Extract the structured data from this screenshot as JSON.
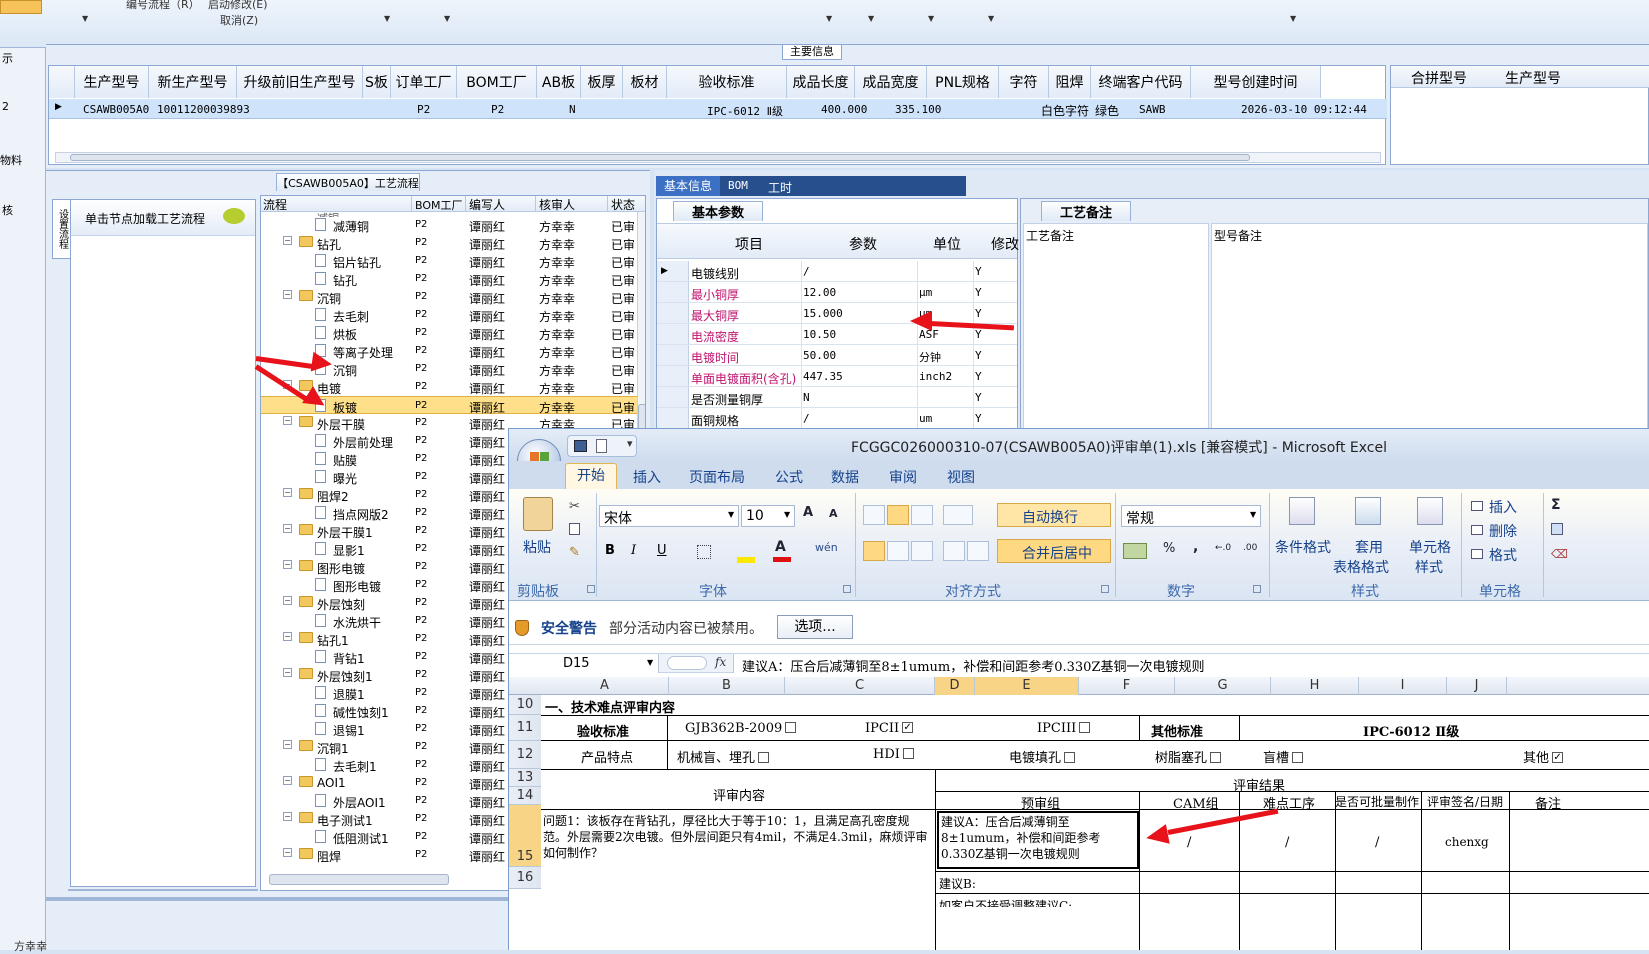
{
  "topbar": {
    "btn1": "编号流程（R）",
    "btn2": "启动修改(E)",
    "btn3": "取消(Z)"
  },
  "left_strip": {
    "items": [
      "示",
      "2",
      "物料",
      "核"
    ]
  },
  "main_info": {
    "title": "主要信息",
    "columns": [
      "生产型号",
      "新生产型号",
      "升级前旧生产型号",
      "S板",
      "订单工厂",
      "BOM工厂",
      "AB板",
      "板厚",
      "板材",
      "验收标准",
      "成品长度",
      "成品宽度",
      "PNL规格",
      "字符",
      "阻焊",
      "终端客户代码",
      "型号创建时间"
    ],
    "row": {
      "model": "CSAWB005A0",
      "new_model": "10011200039893",
      "order_factory": "P2",
      "bom_factory": "P2",
      "ab": "N",
      "standard": "IPC-6012 Ⅱ级",
      "length": "400.000",
      "width": "335.100",
      "char": "白色字符",
      "mask": "绿色",
      "customer": "SAWB",
      "created": "2026-03-10 09:12:44"
    },
    "side_columns": [
      "合拼型号",
      "生产型号"
    ]
  },
  "process": {
    "title": "【CSAWB005A0】工艺流程",
    "vtab": "设置流程",
    "hint": "单击节点加载工艺流程",
    "columns": [
      "流程",
      "BOM工厂",
      "编写人",
      "核审人",
      "状态"
    ],
    "rows": [
      {
        "name": "减薄铜",
        "level": 2
      },
      {
        "name": "钻孔",
        "level": 1
      },
      {
        "name": "铝片钻孔",
        "level": 2
      },
      {
        "name": "钻孔",
        "level": 2
      },
      {
        "name": "沉铜",
        "level": 1
      },
      {
        "name": "去毛刺",
        "level": 2
      },
      {
        "name": "烘板",
        "level": 2
      },
      {
        "name": "等离子处理",
        "level": 2
      },
      {
        "name": "沉铜",
        "level": 2
      },
      {
        "name": "电镀",
        "level": 1
      },
      {
        "name": "板镀",
        "level": 2,
        "selected": true
      },
      {
        "name": "外层干膜",
        "level": 1
      },
      {
        "name": "外层前处理",
        "level": 2
      },
      {
        "name": "贴膜",
        "level": 2
      },
      {
        "name": "曝光",
        "level": 2
      },
      {
        "name": "阻焊2",
        "level": 1
      },
      {
        "name": "挡点网版2",
        "level": 2
      },
      {
        "name": "外层干膜1",
        "level": 1
      },
      {
        "name": "显影1",
        "level": 2
      },
      {
        "name": "图形电镀",
        "level": 1
      },
      {
        "name": "图形电镀",
        "level": 2
      },
      {
        "name": "外层蚀刻",
        "level": 1
      },
      {
        "name": "水洗烘干",
        "level": 2
      },
      {
        "name": "钻孔1",
        "level": 1
      },
      {
        "name": "背钻1",
        "level": 2
      },
      {
        "name": "外层蚀刻1",
        "level": 1
      },
      {
        "name": "退膜1",
        "level": 2
      },
      {
        "name": "碱性蚀刻1",
        "level": 2
      },
      {
        "name": "退锡1",
        "level": 2
      },
      {
        "name": "沉铜1",
        "level": 1
      },
      {
        "name": "去毛刺1",
        "level": 2
      },
      {
        "name": "AOI1",
        "level": 1
      },
      {
        "name": "外层AOI1",
        "level": 2
      },
      {
        "name": "电子测试1",
        "level": 1
      },
      {
        "name": "低阻测试1",
        "level": 2
      },
      {
        "name": "阻焊",
        "level": 1
      }
    ],
    "bom": "P2",
    "writer": "谭丽红",
    "checker": "方幸幸",
    "status": "已审",
    "partial_top": "减铜"
  },
  "detail": {
    "tabs": [
      "基本信息",
      "BOM",
      "工时"
    ],
    "basic_title": "基本参数",
    "process_note_title": "工艺备注",
    "columns": [
      "项目",
      "参数",
      "单位",
      "修改"
    ],
    "note_columns": [
      "工艺备注",
      "型号备注"
    ],
    "params": [
      {
        "name": "电镀线别",
        "value": "/",
        "unit": "",
        "flag": "Y",
        "color": "#000"
      },
      {
        "name": "最小铜厚",
        "value": "12.00",
        "unit": "μm",
        "flag": "Y",
        "color": "#c0136e"
      },
      {
        "name": "最大铜厚",
        "value": "15.000",
        "unit": "μm",
        "flag": "Y",
        "color": "#c0136e"
      },
      {
        "name": "电流密度",
        "value": "10.50",
        "unit": "ASF",
        "flag": "Y",
        "color": "#c0136e"
      },
      {
        "name": "电镀时间",
        "value": "50.00",
        "unit": "分钟",
        "flag": "Y",
        "color": "#c0136e"
      },
      {
        "name": "单面电镀面积(含孔)",
        "value": "447.35",
        "unit": "inch2",
        "flag": "Y",
        "color": "#c0136e"
      },
      {
        "name": "是否测量铜厚",
        "value": "N",
        "unit": "",
        "flag": "Y",
        "color": "#000"
      },
      {
        "name": "面铜规格",
        "value": "/",
        "unit": "um",
        "flag": "Y",
        "color": "#000"
      }
    ]
  },
  "excel": {
    "title": "FCGGC026000310-07(CSAWB005A0)评审单(1).xls  [兼容模式] - Microsoft Excel",
    "tabs": [
      "开始",
      "插入",
      "页面布局",
      "公式",
      "数据",
      "审阅",
      "视图"
    ],
    "font_name": "宋体",
    "font_size": "10",
    "number_format": "常规",
    "buttons": {
      "paste": "粘贴",
      "wrap": "自动换行",
      "merge": "合并后居中",
      "cond": "条件格式",
      "table1": "套用",
      "table2": "表格格式",
      "cell1": "单元格",
      "cell2": "样式",
      "insert": "插入",
      "delete": "删除",
      "format": "格式"
    },
    "groups": [
      "剪贴板",
      "字体",
      "对齐方式",
      "数字",
      "样式",
      "单元格"
    ],
    "security_label": "安全警告",
    "security_text": "部分活动内容已被禁用。",
    "options_btn": "选项...",
    "namebox": "D15",
    "fx": "fx",
    "formula": "建议A：压合后减薄铜至8±1umum，补偿和间距参考0.330Z基铜一次电镀规则",
    "col_headers": [
      "A",
      "B",
      "C",
      "D",
      "E",
      "F",
      "G",
      "H",
      "I",
      "J"
    ],
    "row_headers": [
      "10",
      "11",
      "12",
      "13",
      "14",
      "15",
      "16"
    ],
    "cells": {
      "r10": "一、技术难点评审内容",
      "accept_std": "验收标准",
      "gjb": "GJB362B-2009",
      "ipc2": "IPCII",
      "ipc3": "IPCIII",
      "other_std": "其他标准",
      "ipc_level": "IPC-6012 Ⅱ级",
      "product_feat": "产品特点",
      "blind": "机械盲、埋孔",
      "hdi": "HDI",
      "fill": "电镀填孔",
      "resin": "树脂塞孔",
      "slot": "盲槽",
      "other": "其他",
      "review_content": "评审内容",
      "review_result": "评审结果",
      "pre_group": "预审组",
      "cam": "CAM组",
      "difficult": "难点工序",
      "batch": "是否可批量制作",
      "sign": "评审签名/日期",
      "note": "备注",
      "q1": "问题1：该板存在背钻孔，厚径比大于等于10：1，且满足高孔密度规范。外层需要2次电镀。但外层间距只有4mil，不满足4.3mil，麻烦评审如何制作？",
      "suggest_a": "建议A：压合后减薄铜至8±1umum，补偿和间距参考0.330Z基铜一次电镀规则",
      "slash": "/",
      "signer": "chenxg",
      "suggest_b": "建议B:",
      "suggest_c": "如客户不接受调整建议C:"
    }
  },
  "status_bar": "方幸幸"
}
